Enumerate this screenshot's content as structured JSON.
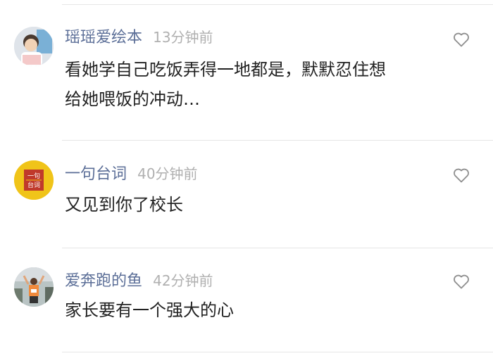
{
  "comments": [
    {
      "name": "瑶瑶爱绘本",
      "time": "13分钟前",
      "text": "看她学自己吃饭弄得一地都是，默默忍住想\n给她喂饭的冲动…",
      "like_icon": "heart-outline-icon"
    },
    {
      "name": "一句台词",
      "time": "40分钟前",
      "text": "又见到你了校长",
      "like_icon": "heart-outline-icon",
      "avatar_logo_text": "一句台词"
    },
    {
      "name": "爱奔跑的鱼",
      "time": "42分钟前",
      "text": "家长要有一个强大的心",
      "like_icon": "heart-outline-icon"
    }
  ],
  "colors": {
    "name": "#5b6e97",
    "time": "#b0b0b0",
    "text": "#222222",
    "divider": "#e6e6e6",
    "logo_red": "#c0392b",
    "logo_yellow": "#f0c419"
  }
}
